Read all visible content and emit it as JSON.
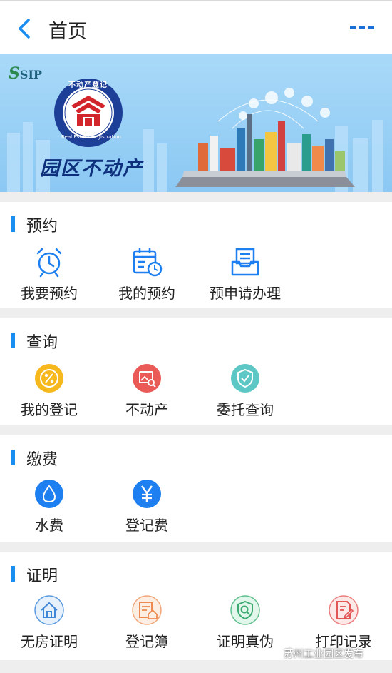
{
  "header": {
    "title": "首页"
  },
  "banner": {
    "brand": "SIP",
    "seal_top_text": "不动产登记",
    "seal_ring_text": "Real Estate Registration",
    "caption": "园区不动产"
  },
  "sections": [
    {
      "title": "预约",
      "items": [
        {
          "label": "我要预约",
          "icon": "alarm-clock-icon"
        },
        {
          "label": "我的预约",
          "icon": "calendar-clock-icon"
        },
        {
          "label": "预申请办理",
          "icon": "document-tray-icon"
        }
      ]
    },
    {
      "title": "查询",
      "items": [
        {
          "label": "我的登记",
          "icon": "percent-coin-icon"
        },
        {
          "label": "不动产",
          "icon": "search-image-icon"
        },
        {
          "label": "委托查询",
          "icon": "shield-check-icon"
        }
      ]
    },
    {
      "title": "缴费",
      "items": [
        {
          "label": "水费",
          "icon": "water-drop-icon"
        },
        {
          "label": "登记费",
          "icon": "yen-icon"
        }
      ]
    },
    {
      "title": "证明",
      "items": [
        {
          "label": "无房证明",
          "icon": "house-icon"
        },
        {
          "label": "登记簿",
          "icon": "register-book-icon"
        },
        {
          "label": "证明真伪",
          "icon": "verify-shield-icon"
        },
        {
          "label": "打印记录",
          "icon": "print-record-icon"
        }
      ]
    }
  ],
  "watermark": "苏州工业园区发布",
  "colors": {
    "accent": "#1a8ef0",
    "banner": "#9fd3f7",
    "icon_yellow": "#f6b81d",
    "icon_red": "#ea5a57",
    "icon_teal": "#5cc7c4",
    "icon_blue": "#1d7ff0"
  }
}
